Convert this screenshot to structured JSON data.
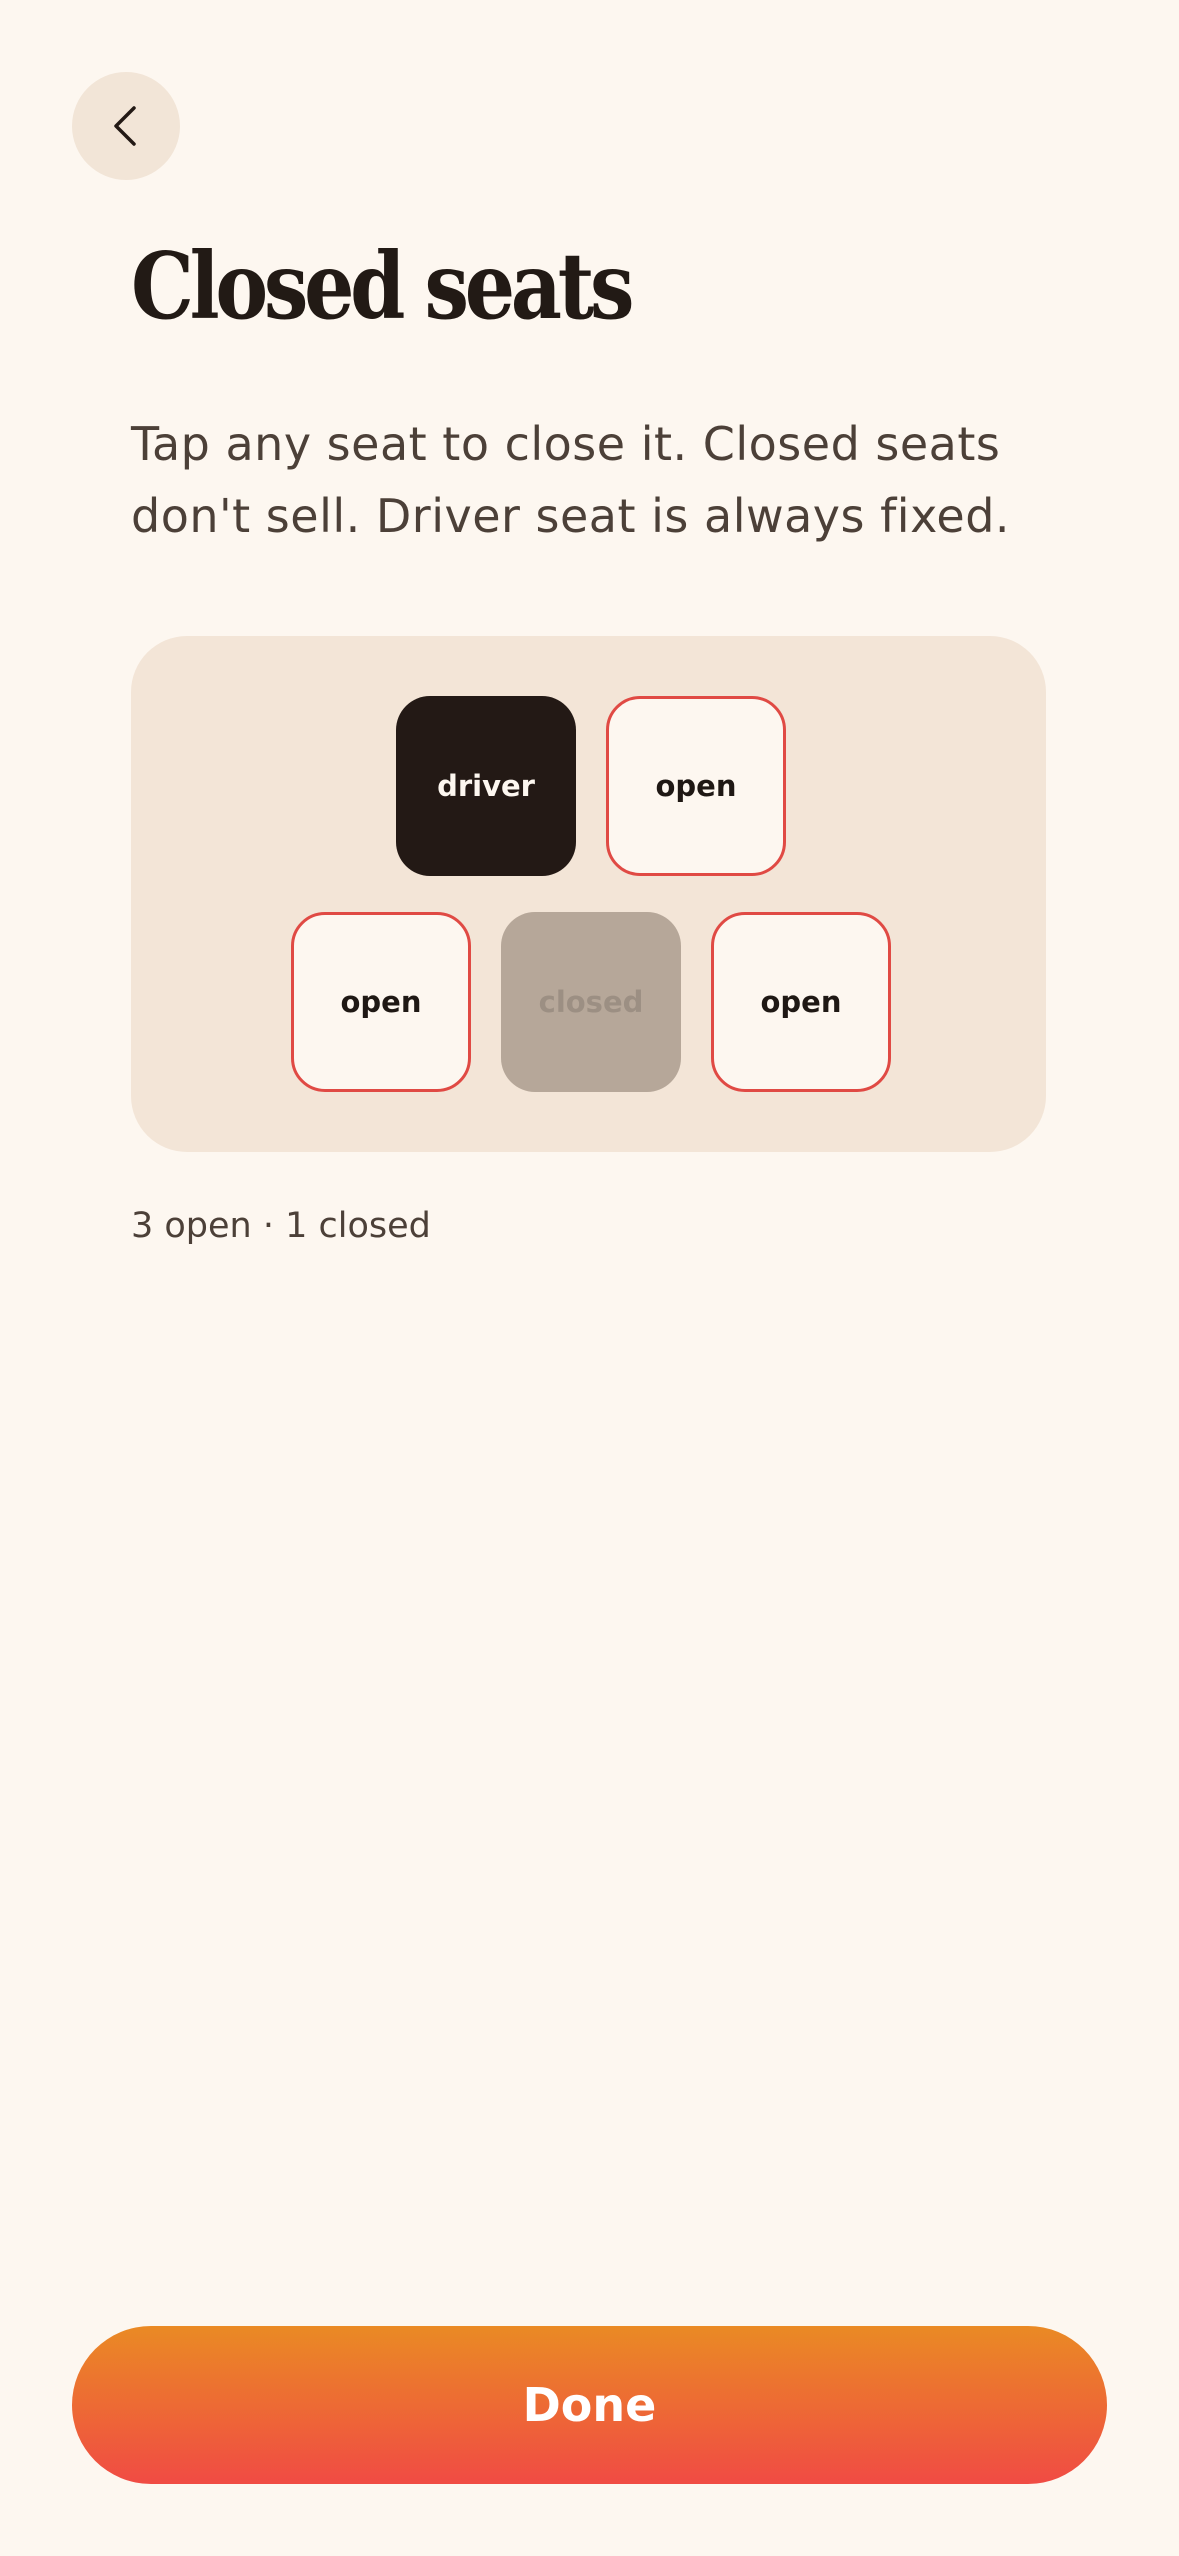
{
  "header": {
    "back_icon": "chevron-left-icon",
    "title": "Closed seats",
    "description": "Tap any seat to close it. Closed seats don't sell. Driver seat is always fixed."
  },
  "seat_map": {
    "rows": [
      [
        {
          "label": "driver",
          "state": "driver"
        },
        {
          "label": "open",
          "state": "open"
        }
      ],
      [
        {
          "label": "open",
          "state": "open"
        },
        {
          "label": "closed",
          "state": "closed"
        },
        {
          "label": "open",
          "state": "open"
        }
      ]
    ],
    "summary": "3 open · 1 closed"
  },
  "footer": {
    "done_label": "Done"
  },
  "colors": {
    "background": "#fdf7f0",
    "panel": "#f3e5d7",
    "open_border": "#e04a44",
    "driver_fill": "#231915",
    "closed_fill": "#b6a799",
    "accent_gradient_top": "#ea8a24",
    "accent_gradient_bottom": "#f04b44"
  }
}
